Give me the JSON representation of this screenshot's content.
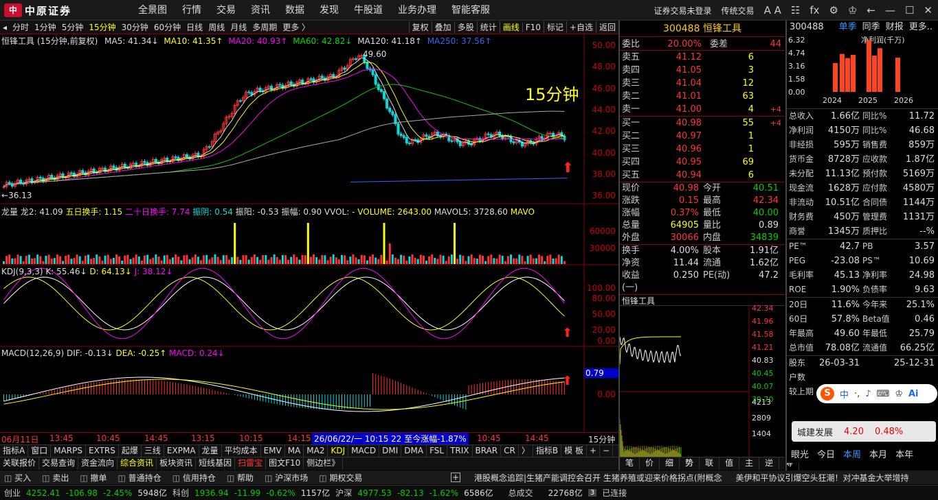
{
  "app": {
    "logo_text": "中原证券",
    "logo_mark": "中"
  },
  "topmenu": [
    "全景图",
    "行情",
    "交易",
    "资讯",
    "数据",
    "发现",
    "牛股道",
    "业务办理",
    "智能客服"
  ],
  "topright": {
    "login": "证券交易未登录",
    "mode": "传统交易",
    "font_icon": "A A",
    "fx_icon": "fx"
  },
  "periods": [
    "分时",
    "1分钟",
    "5分钟",
    "15分钟",
    "30分钟",
    "60分钟",
    "日线",
    "周线",
    "月线",
    "多周期",
    "更多 〉"
  ],
  "period_active": "15分钟",
  "toolbar": [
    "复权",
    "叠加",
    "多股",
    "统计",
    "画线",
    "F10",
    "标记",
    "+自选",
    "返回"
  ],
  "main_chart": {
    "ma_line": "恒锋工具 (15分钟,前复权)",
    "ma5": "MA5: 41.34↓",
    "ma10": "MA10: 41.35↑",
    "ma20": "MA20: 40.93↑",
    "ma60": "MA60: 42.82↓",
    "ma120": "MA120: 41.18↑",
    "ma250": "MA250: 37.56↑",
    "yticks": [
      "50.00",
      "48.00",
      "46.00",
      "44.00",
      "42.00",
      "40.00",
      "38.00",
      "36.00"
    ],
    "high_label": "49.60",
    "low_label": "36.13",
    "period_watermark": "15分钟"
  },
  "vol_panel": {
    "title": "龙量",
    "long2": "龙2: 41.09",
    "wuri": "五日换手: 1.15",
    "ershi": "二十日换手: 7.74",
    "zhenyin": "振阴: 0.54",
    "zhenyang": "振阳: -0.53",
    "zhenfu": "振幅: 0.90",
    "vvol": "VVOL: -",
    "volume": "VOLUME: 2643.00",
    "mavol5": "MAVOL5: 3728.60",
    "mavol_more": "MAVO",
    "yticks": [
      "60000",
      "30000"
    ]
  },
  "kdj_panel": {
    "title": "KDJ(9,3,3)",
    "k": "K: 55.46↓",
    "d": "D: 64.13↓",
    "j": "J: 38.12↓",
    "yticks": [
      "100.00",
      "80.00",
      "50.00",
      "20.00",
      "0.00"
    ]
  },
  "macd_panel": {
    "title": "MACD(12,26,9)",
    "dif": "DIF: -0.13↓",
    "dea": "DEA: -0.25↑",
    "macd": "MACD: 0.24↓",
    "yticks": [
      "0.00"
    ],
    "cursor_value": "0.79"
  },
  "time_axis": {
    "date": "06月11日",
    "ticks": [
      "13:45",
      "10:45",
      "14:45",
      "13:15",
      "10:15",
      "14:15",
      "10:45",
      "14:45"
    ],
    "cursor": "26/06/22/一 10:15 22 至今涨幅-1.87%",
    "period": "15分钟"
  },
  "indicator_tabs": [
    "指标A",
    "窗口",
    "MARPS",
    "EXTRS",
    "起爆",
    "三线",
    "EXPMA",
    "龙量",
    "平均成本",
    "EMV",
    "MA",
    "MA2",
    "KDJ",
    "MACD",
    "DMI",
    "DMA",
    "FSL",
    "TRIX",
    "BRAR",
    "CR",
    "〉",
    "指标B",
    "模 板",
    "+",
    "−"
  ],
  "info_tabs": [
    "关联报价",
    "交易查询",
    "资金流向",
    "综合资讯",
    "板块资讯",
    "短线基因",
    "扫雷宝",
    "图文F10",
    "侧边栏》"
  ],
  "quote": {
    "code_name": "300488 恒锋工具",
    "weibi": "20.00%",
    "weicha": "44",
    "sells": [
      {
        "l": "卖五",
        "p": "41.12",
        "v": "6",
        "d": ""
      },
      {
        "l": "卖四",
        "p": "41.05",
        "v": "3",
        "d": ""
      },
      {
        "l": "卖三",
        "p": "41.04",
        "v": "12",
        "d": ""
      },
      {
        "l": "卖二",
        "p": "41.01",
        "v": "63",
        "d": ""
      },
      {
        "l": "卖一",
        "p": "41.00",
        "v": "4",
        "d": "+4"
      }
    ],
    "buys": [
      {
        "l": "买一",
        "p": "40.98",
        "v": "55",
        "d": "+4"
      },
      {
        "l": "买二",
        "p": "40.97",
        "v": "1",
        "d": ""
      },
      {
        "l": "买三",
        "p": "40.96",
        "v": "1",
        "d": ""
      },
      {
        "l": "买四",
        "p": "40.95",
        "v": "69",
        "d": ""
      },
      {
        "l": "买五",
        "p": "40.94",
        "v": "6",
        "d": ""
      }
    ],
    "stats": [
      [
        "现价",
        "40.98",
        "今开",
        "40.51"
      ],
      [
        "涨跌",
        "0.15",
        "最高",
        "42.34"
      ],
      [
        "涨幅",
        "0.37%",
        "最低",
        "40.00"
      ],
      [
        "总量",
        "64905",
        "量比",
        "0.89"
      ],
      [
        "外盘",
        "30066",
        "内盘",
        "34839"
      ]
    ],
    "stats2": [
      [
        "换手",
        "4.00%",
        "股本",
        "1.91亿"
      ],
      [
        "净资",
        "11.44",
        "流通",
        "1.62亿"
      ],
      [
        "收益(一)",
        "0.250",
        "PE(动)",
        "47.2"
      ]
    ],
    "mini_title": "恒锋工具",
    "mini_prices": [
      "42.34",
      "41.96",
      "41.58",
      "41.21",
      "40.83",
      "40.45",
      "40.07",
      "39.70"
    ],
    "mini_vol": [
      "4213",
      "2809",
      "1404"
    ],
    "bottom_tabs": [
      "笔",
      "价",
      "细",
      "势",
      "联",
      "值",
      "主",
      "逆",
      "筹"
    ]
  },
  "right": {
    "code": "300488",
    "tabs": [
      "单季",
      "同季",
      "财报",
      "更多.."
    ],
    "bar_title": "净利润(千万)",
    "bar_y": [
      "6.32",
      "4.74",
      "3.16",
      "1.58",
      "0.00"
    ],
    "bar_x": [
      "2024",
      "2025",
      "2026"
    ],
    "bar_values": [
      3.5,
      4.6,
      4.1,
      4.5,
      6.3,
      4.4,
      5.3,
      4.15
    ],
    "rows1": [
      [
        "总收入",
        "1.66亿",
        "同比%",
        "11.72"
      ],
      [
        "净利润",
        "4150万",
        "同比%",
        "46.68"
      ],
      [
        "非经损",
        "595万",
        "销售费",
        "859万"
      ],
      [
        "货币金",
        "8728万",
        "应收款",
        "1.87亿"
      ],
      [
        "未分配",
        "11.13亿",
        "预付款",
        "5169万"
      ],
      [
        "现金流",
        "1628万",
        "应付款",
        "4580万"
      ],
      [
        "非流动",
        "10.51亿",
        "合同债",
        "1144万"
      ],
      [
        "财务费",
        "450万",
        "管理费",
        "1131万"
      ],
      [
        "商誉",
        "1345万",
        "质押比",
        "--%"
      ]
    ],
    "rows2": [
      [
        "PE™",
        "42.7",
        "PB",
        "3.57"
      ],
      [
        "PEG",
        "-23.08",
        "PS™",
        "10.69"
      ],
      [
        "毛利率",
        "45.13",
        "净利率",
        "24.98"
      ],
      [
        "ROE",
        "1.90%",
        "负债率",
        "9.63"
      ]
    ],
    "rows3": [
      [
        "20日",
        "11.6%",
        "今年来",
        "25.1%"
      ],
      [
        "60日",
        "57.8%",
        "Beta值",
        "0.46"
      ],
      [
        "年最高",
        "49.60",
        "年最低",
        "25.79"
      ],
      [
        "总市值",
        "78.08亿",
        "流通值",
        "66.25亿"
      ]
    ],
    "rows4": [
      [
        "股东",
        "26-03-31",
        "",
        "25-12-31"
      ],
      [
        "户数",
        "",
        "",
        ""
      ],
      [
        "较上期",
        "",
        "",
        ""
      ]
    ],
    "popup": {
      "name": "城建发展",
      "price": "4.20",
      "pct": "0.48%"
    },
    "bottom_tabs": [
      "眼光",
      "今日",
      "本周",
      "本月",
      "本年"
    ]
  },
  "bottom_bar": [
    "买入",
    "卖出",
    "撤单",
    "普通持仓",
    "信用持仓",
    "帮助",
    "沪深市场",
    "期权交易"
  ],
  "news": "港股概念追踪|生猪产能调控会召开 生猪养殖或迎来价格拐点(附概念",
  "news2": "美伊和平协议引爆空头狂潮！对冲基金大举增持",
  "index_bar": {
    "chuangye": "创业",
    "cy_val": "4252.41",
    "cy_chg": "-106.98",
    "cy_pct": "-2.45%",
    "cy_amt": "5948亿",
    "kechuang": "科创",
    "kc_val": "1936.94",
    "kc_chg": "-11.99",
    "kc_pct": "-0.62%",
    "kc_amt": "1157亿",
    "hushen": "沪深",
    "hs_val": "4977.53",
    "hs_chg": "-82.13",
    "hs_pct": "-1.62%",
    "hs_amt": "6586亿",
    "total_label": "总成交",
    "total": "22768亿",
    "connected": "已连接"
  }
}
